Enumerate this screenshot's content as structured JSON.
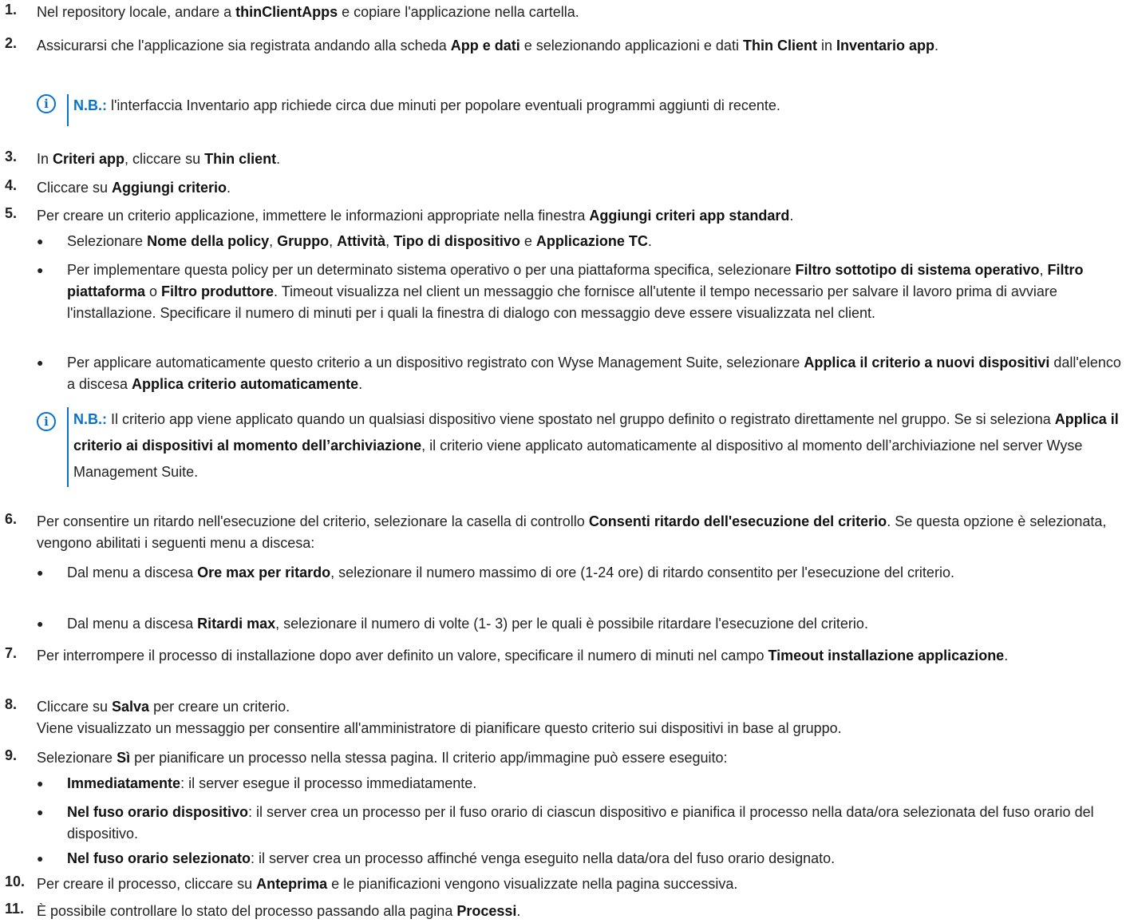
{
  "steps": [
    {
      "num": "1.",
      "parts": [
        "Nel repository locale, andare a ",
        "thinClientApps",
        " e copiare l'applicazione nella cartella."
      ]
    },
    {
      "num": "2.",
      "parts": [
        "Assicurarsi che l'applicazione sia registrata andando alla scheda ",
        "App e dati",
        " e selezionando applicazioni e dati ",
        "Thin Client",
        " in ",
        "Inventario app",
        "."
      ]
    },
    {
      "num": "3.",
      "parts": [
        "In ",
        "Criteri app",
        ", cliccare su ",
        "Thin client",
        "."
      ]
    },
    {
      "num": "4.",
      "parts": [
        "Cliccare su ",
        "Aggiungi criterio",
        "."
      ]
    },
    {
      "num": "5.",
      "parts": [
        "Per creare un criterio applicazione, immettere le informazioni appropriate nella finestra ",
        "Aggiungi criteri app standard",
        "."
      ]
    },
    {
      "num": "6.",
      "parts": [
        "Per consentire un ritardo nell'esecuzione del criterio, selezionare la casella di controllo ",
        "Consenti ritardo dell'esecuzione del criterio",
        ". Se questa opzione è selezionata, vengono abilitati i seguenti menu a discesa:"
      ]
    },
    {
      "num": "7.",
      "parts": [
        "Per interrompere il processo di installazione dopo aver definito un valore, specificare il numero di minuti nel campo ",
        "Timeout installazione applicazione",
        "."
      ]
    },
    {
      "num": "8.",
      "parts": [
        "Cliccare su ",
        "Salva",
        " per creare un criterio."
      ],
      "extra": "Viene visualizzato un messaggio per consentire all'amministratore di pianificare questo criterio sui dispositivi in base al gruppo."
    },
    {
      "num": "9.",
      "parts": [
        "Selezionare ",
        "Sì",
        " per pianificare un processo nella stessa pagina. Il criterio app/immagine può essere eseguito:"
      ]
    },
    {
      "num": "10.",
      "parts": [
        "Per creare il processo, cliccare su ",
        "Anteprima",
        " e le pianificazioni vengono visualizzate nella pagina successiva."
      ]
    },
    {
      "num": "11.",
      "parts": [
        "È possibile controllare lo stato del processo passando alla pagina ",
        "Processi",
        "."
      ]
    }
  ],
  "step5_bullets": [
    {
      "parts": [
        "Selezionare ",
        "Nome della policy",
        ", ",
        "Gruppo",
        ", ",
        "Attività",
        ", ",
        "Tipo di dispositivo",
        " e ",
        "Applicazione TC",
        "."
      ]
    },
    {
      "parts": [
        "Per implementare questa policy per un determinato sistema operativo o per una piattaforma specifica, selezionare ",
        "Filtro sottotipo di sistema operativo",
        ", ",
        "Filtro piattaforma",
        " o ",
        "Filtro produttore",
        ". Timeout visualizza nel client un messaggio che fornisce all'utente il tempo necessario per salvare il lavoro prima di avviare l'installazione. Specificare il numero di minuti per i quali la finestra di dialogo con messaggio deve essere visualizzata nel client."
      ]
    },
    {
      "parts": [
        "Per applicare automaticamente questo criterio a un dispositivo registrato con Wyse Management Suite, selezionare ",
        "Applica il criterio a nuovi dispositivi",
        " dall'elenco a discesa ",
        "Applica criterio automaticamente",
        "."
      ]
    }
  ],
  "step6_bullets": [
    {
      "parts": [
        "Dal menu a discesa ",
        "Ore max per ritardo",
        ", selezionare il numero massimo di ore (1-24 ore) di ritardo consentito per l'esecuzione del criterio."
      ]
    },
    {
      "parts": [
        "Dal menu a discesa ",
        "Ritardi max",
        ", selezionare il numero di volte (1- 3) per le quali è possibile ritardare l'esecuzione del criterio."
      ]
    }
  ],
  "step9_bullets": [
    {
      "parts": [
        "Immediatamente",
        ": il server esegue il processo immediatamente."
      ]
    },
    {
      "parts": [
        "Nel fuso orario dispositivo",
        ": il server crea un processo per il fuso orario di ciascun dispositivo e pianifica il processo nella data/ora selezionata del fuso orario del dispositivo."
      ]
    },
    {
      "parts": [
        "Nel fuso orario selezionato",
        ": il server crea un processo affinché venga eseguito nella data/ora del fuso orario designato."
      ]
    }
  ],
  "notes": [
    {
      "label": "N.B.:",
      "parts": [
        " l'interfaccia Inventario app richiede circa due minuti per popolare eventuali programmi aggiunti di recente."
      ]
    },
    {
      "label": "N.B.:",
      "parts": [
        " Il criterio app viene applicato quando un qualsiasi dispositivo viene spostato nel gruppo definito o registrato direttamente nel gruppo. Se si seleziona ",
        "Applica il criterio ai dispositivi al momento dell’archiviazione",
        ", il criterio viene applicato automaticamente al dispositivo al momento dell’archiviazione nel server Wyse Management Suite."
      ]
    }
  ],
  "icons": {
    "info": "i",
    "bullet": "●"
  },
  "colors": {
    "accent": "#0672cb",
    "text": "#222222"
  }
}
